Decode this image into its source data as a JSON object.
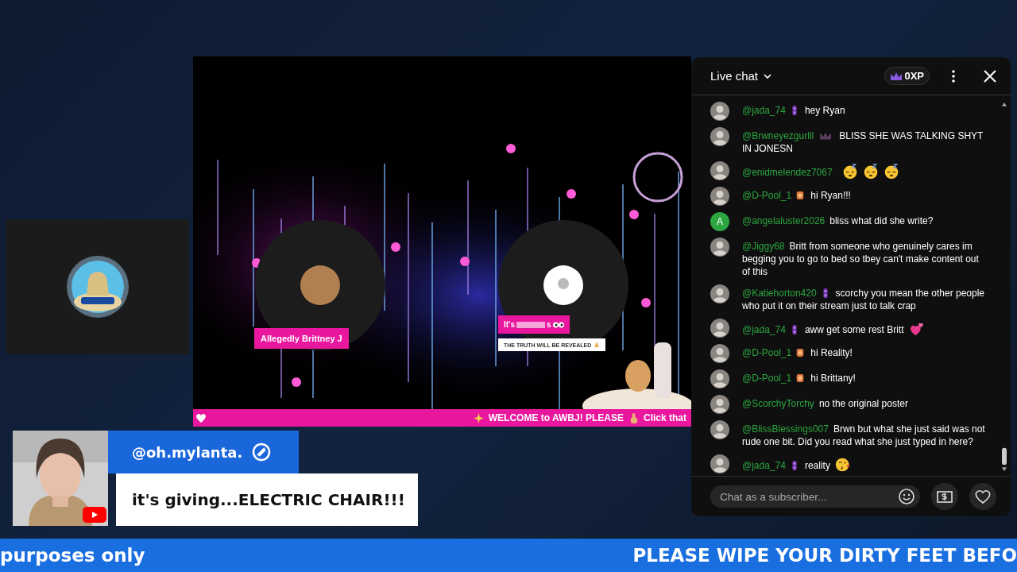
{
  "stage": {
    "host_tag": "Allegedly Brittney J",
    "guest_tag": {
      "prefix": "It's",
      "suffix": "s"
    },
    "guest_subtitle": "THE TRUTH WILL BE REVEALED",
    "ticker": [
      "WELCOME to AWBJ! PLEASE",
      "Click that"
    ]
  },
  "chat": {
    "title": "Live chat",
    "xp": "0XP",
    "placeholder": "Chat as a subscriber...",
    "messages": [
      {
        "author": "@jada_74",
        "badge": {
          "kind": "member"
        },
        "text": "hey Ryan"
      },
      {
        "author": "@Brwneyezgurlll",
        "badge": {
          "kind": "crown"
        },
        "text": "BLISS SHE WAS TALKING SHYT IN JONESN"
      },
      {
        "author": "@enidmelendez7067",
        "reactions": [
          {
            "kind": "sleepy"
          },
          {
            "kind": "sleepy"
          },
          {
            "kind": "sleepy"
          }
        ]
      },
      {
        "author": "@D-Pool_1",
        "badge": {
          "kind": "supporter"
        },
        "text": "hi Ryan!!!"
      },
      {
        "author": "@angelaluster2026",
        "avatar_letter": "A",
        "color": "#2ba640",
        "text": "bliss what did she write?"
      },
      {
        "author": "@Jiggy68",
        "text": "Britt from someone who genuinely cares im begging you to go to bed so tbey can't make content out of this"
      },
      {
        "author": "@Katiehorton420",
        "badge": {
          "kind": "member"
        },
        "text": "scorchy you mean the other people who put it on their stream just to talk crap"
      },
      {
        "author": "@jada_74",
        "badge": {
          "kind": "member"
        },
        "text": "aww get some rest Britt",
        "reactions": [
          {
            "kind": "hearts"
          }
        ]
      },
      {
        "author": "@D-Pool_1",
        "badge": {
          "kind": "supporter"
        },
        "text": "hi Reality!"
      },
      {
        "author": "@D-Pool_1",
        "badge": {
          "kind": "supporter"
        },
        "text": "hi Brittany!"
      },
      {
        "author": "@ScorchyTorchy",
        "text": "no the original poster"
      },
      {
        "author": "@BlissBlessings007",
        "text": "Brwn but what she just said was not rude one bit. Did you read what she just typed in here?"
      },
      {
        "author": "@jada_74",
        "badge": {
          "kind": "member"
        },
        "text": "reality",
        "reactions": [
          {
            "kind": "kiss"
          }
        ]
      }
    ]
  },
  "comment": {
    "author": "@oh.mylanta.",
    "text": "it's giving...ELECTRIC CHAIR!!!"
  },
  "banner": [
    "purposes only",
    "PLEASE WIPE YOUR DIRTY FEET BEFO"
  ]
}
